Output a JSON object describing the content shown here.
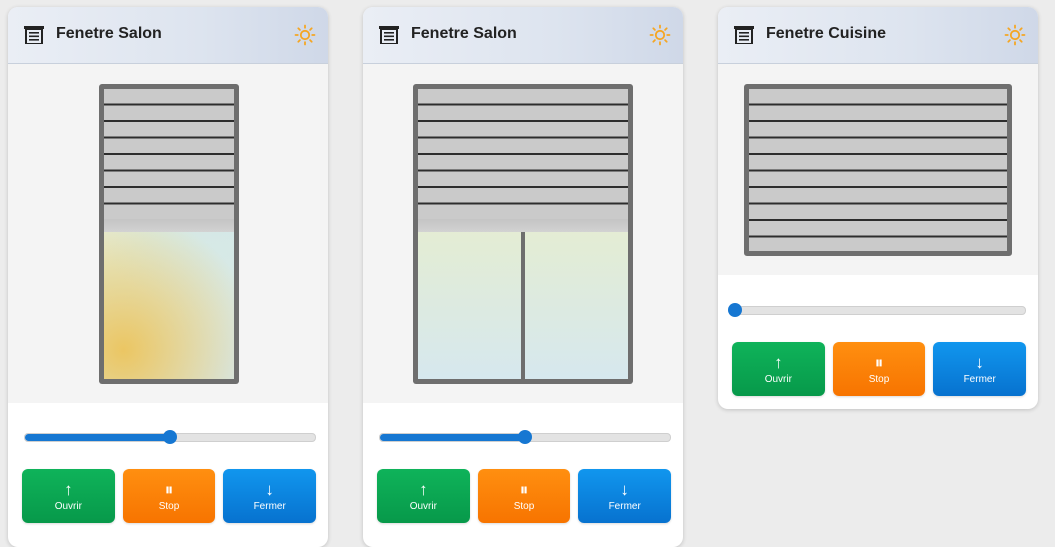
{
  "cards": [
    {
      "title": "Fenetre Salon",
      "position": 50,
      "buttons": {
        "open": {
          "icon": "↑",
          "label": "Ouvrir"
        },
        "stop": {
          "icon": "⏸",
          "label": "Stop"
        },
        "close": {
          "icon": "↓",
          "label": "Fermer"
        }
      }
    },
    {
      "title": "Fenetre Salon",
      "position": 50,
      "buttons": {
        "open": {
          "icon": "↑",
          "label": "Ouvrir"
        },
        "stop": {
          "icon": "⏸",
          "label": "Stop"
        },
        "close": {
          "icon": "↓",
          "label": "Fermer"
        }
      }
    },
    {
      "title": "Fenetre Cuisine",
      "position": 0,
      "buttons": {
        "open": {
          "icon": "↑",
          "label": "Ouvrir"
        },
        "stop": {
          "icon": "⏸",
          "label": "Stop"
        },
        "close": {
          "icon": "↓",
          "label": "Fermer"
        }
      }
    }
  ],
  "icons": {
    "header": "window-shutter-icon",
    "status": "sun-icon"
  },
  "colors": {
    "open": "#07a652",
    "stop": "#fb7f00",
    "close": "#0b84e0",
    "slider": "#1677d2",
    "sun": "#f5a623"
  }
}
